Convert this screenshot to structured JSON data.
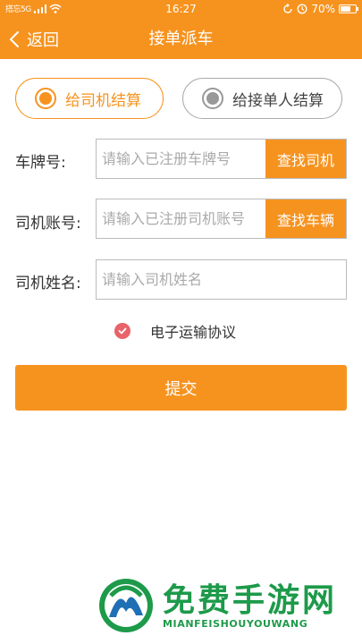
{
  "status_bar": {
    "carrier_text": "搭忘5G",
    "time": "16:27",
    "battery_percent": "70%",
    "battery_level": 0.7
  },
  "nav": {
    "back_label": "返回",
    "title": "接单派车"
  },
  "settlement": {
    "options": [
      {
        "label": "给司机结算",
        "selected": true
      },
      {
        "label": "给接单人结算",
        "selected": false
      }
    ]
  },
  "form": {
    "plate": {
      "label": "车牌号:",
      "placeholder": "请输入已注册车牌号",
      "button": "查找司机"
    },
    "account": {
      "label": "司机账号:",
      "placeholder": "请输入已注册司机账号",
      "button": "查找车辆"
    },
    "name": {
      "label": "司机姓名:",
      "placeholder": "请输入司机姓名"
    }
  },
  "agreement": {
    "label": "电子运输协议",
    "checked": true
  },
  "submit_label": "提交",
  "watermark": {
    "cn": "免费手游网",
    "en": "MIANFEISHOUYOUWANG"
  },
  "colors": {
    "accent": "#f6931f",
    "check": "#e8636a",
    "watermark": "#1d9a4a"
  }
}
